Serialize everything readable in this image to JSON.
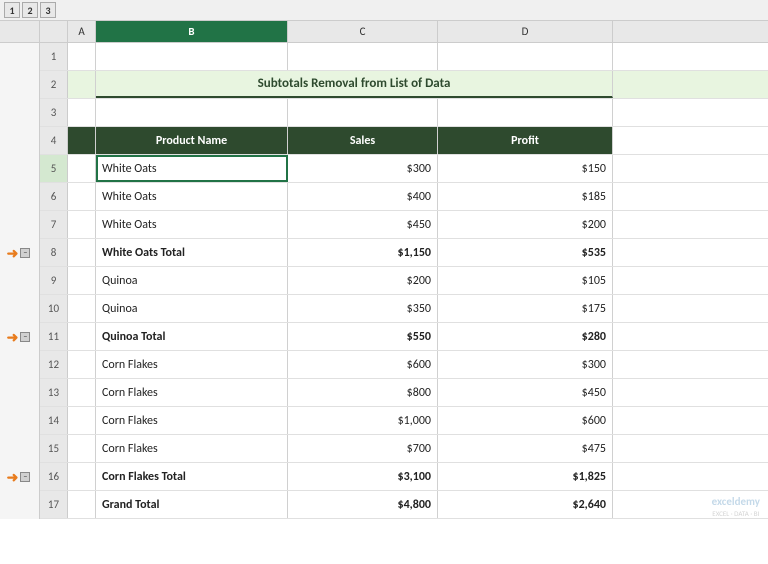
{
  "outline": {
    "levels": [
      "1",
      "2",
      "3"
    ]
  },
  "title": "Subtotals Removal from List of Data",
  "columns": {
    "a": {
      "label": "A",
      "width": 28
    },
    "b": {
      "label": "B",
      "width": 192
    },
    "c": {
      "label": "C",
      "width": 150
    },
    "d": {
      "label": "D",
      "width": 175
    }
  },
  "headers": {
    "product_name": "Product Name",
    "sales": "Sales",
    "profit": "Profit"
  },
  "rows": [
    {
      "num": "1",
      "type": "empty"
    },
    {
      "num": "2",
      "type": "title"
    },
    {
      "num": "3",
      "type": "empty"
    },
    {
      "num": "4",
      "type": "header"
    },
    {
      "num": "5",
      "type": "data",
      "product": "White Oats",
      "sales": "$300",
      "profit": "$150",
      "selected": true
    },
    {
      "num": "6",
      "type": "data",
      "product": "White Oats",
      "sales": "$400",
      "profit": "$185"
    },
    {
      "num": "7",
      "type": "data",
      "product": "White Oats",
      "sales": "$450",
      "profit": "$200"
    },
    {
      "num": "8",
      "type": "subtotal",
      "product": "White Oats Total",
      "sales": "$1,150",
      "profit": "$535",
      "arrow": true
    },
    {
      "num": "9",
      "type": "data",
      "product": "Quinoa",
      "sales": "$200",
      "profit": "$105"
    },
    {
      "num": "10",
      "type": "data",
      "product": "Quinoa",
      "sales": "$350",
      "profit": "$175"
    },
    {
      "num": "11",
      "type": "subtotal",
      "product": "Quinoa Total",
      "sales": "$550",
      "profit": "$280",
      "arrow": true
    },
    {
      "num": "12",
      "type": "data",
      "product": "Corn Flakes",
      "sales": "$600",
      "profit": "$300"
    },
    {
      "num": "13",
      "type": "data",
      "product": "Corn Flakes",
      "sales": "$800",
      "profit": "$450"
    },
    {
      "num": "14",
      "type": "data",
      "product": "Corn Flakes",
      "sales": "$1,000",
      "profit": "$600"
    },
    {
      "num": "15",
      "type": "data",
      "product": "Corn Flakes",
      "sales": "$700",
      "profit": "$475"
    },
    {
      "num": "16",
      "type": "subtotal",
      "product": "Corn Flakes Total",
      "sales": "$3,100",
      "profit": "$1,825",
      "arrow": true
    },
    {
      "num": "17",
      "type": "grand",
      "product": "Grand Total",
      "sales": "$4,800",
      "profit": "$2,640"
    }
  ],
  "arrow_rows": [
    "8",
    "11",
    "16"
  ],
  "collapse_rows": [
    "8",
    "11",
    "16"
  ],
  "watermark": "exceldemy\nEXCEL · DATA · BI"
}
